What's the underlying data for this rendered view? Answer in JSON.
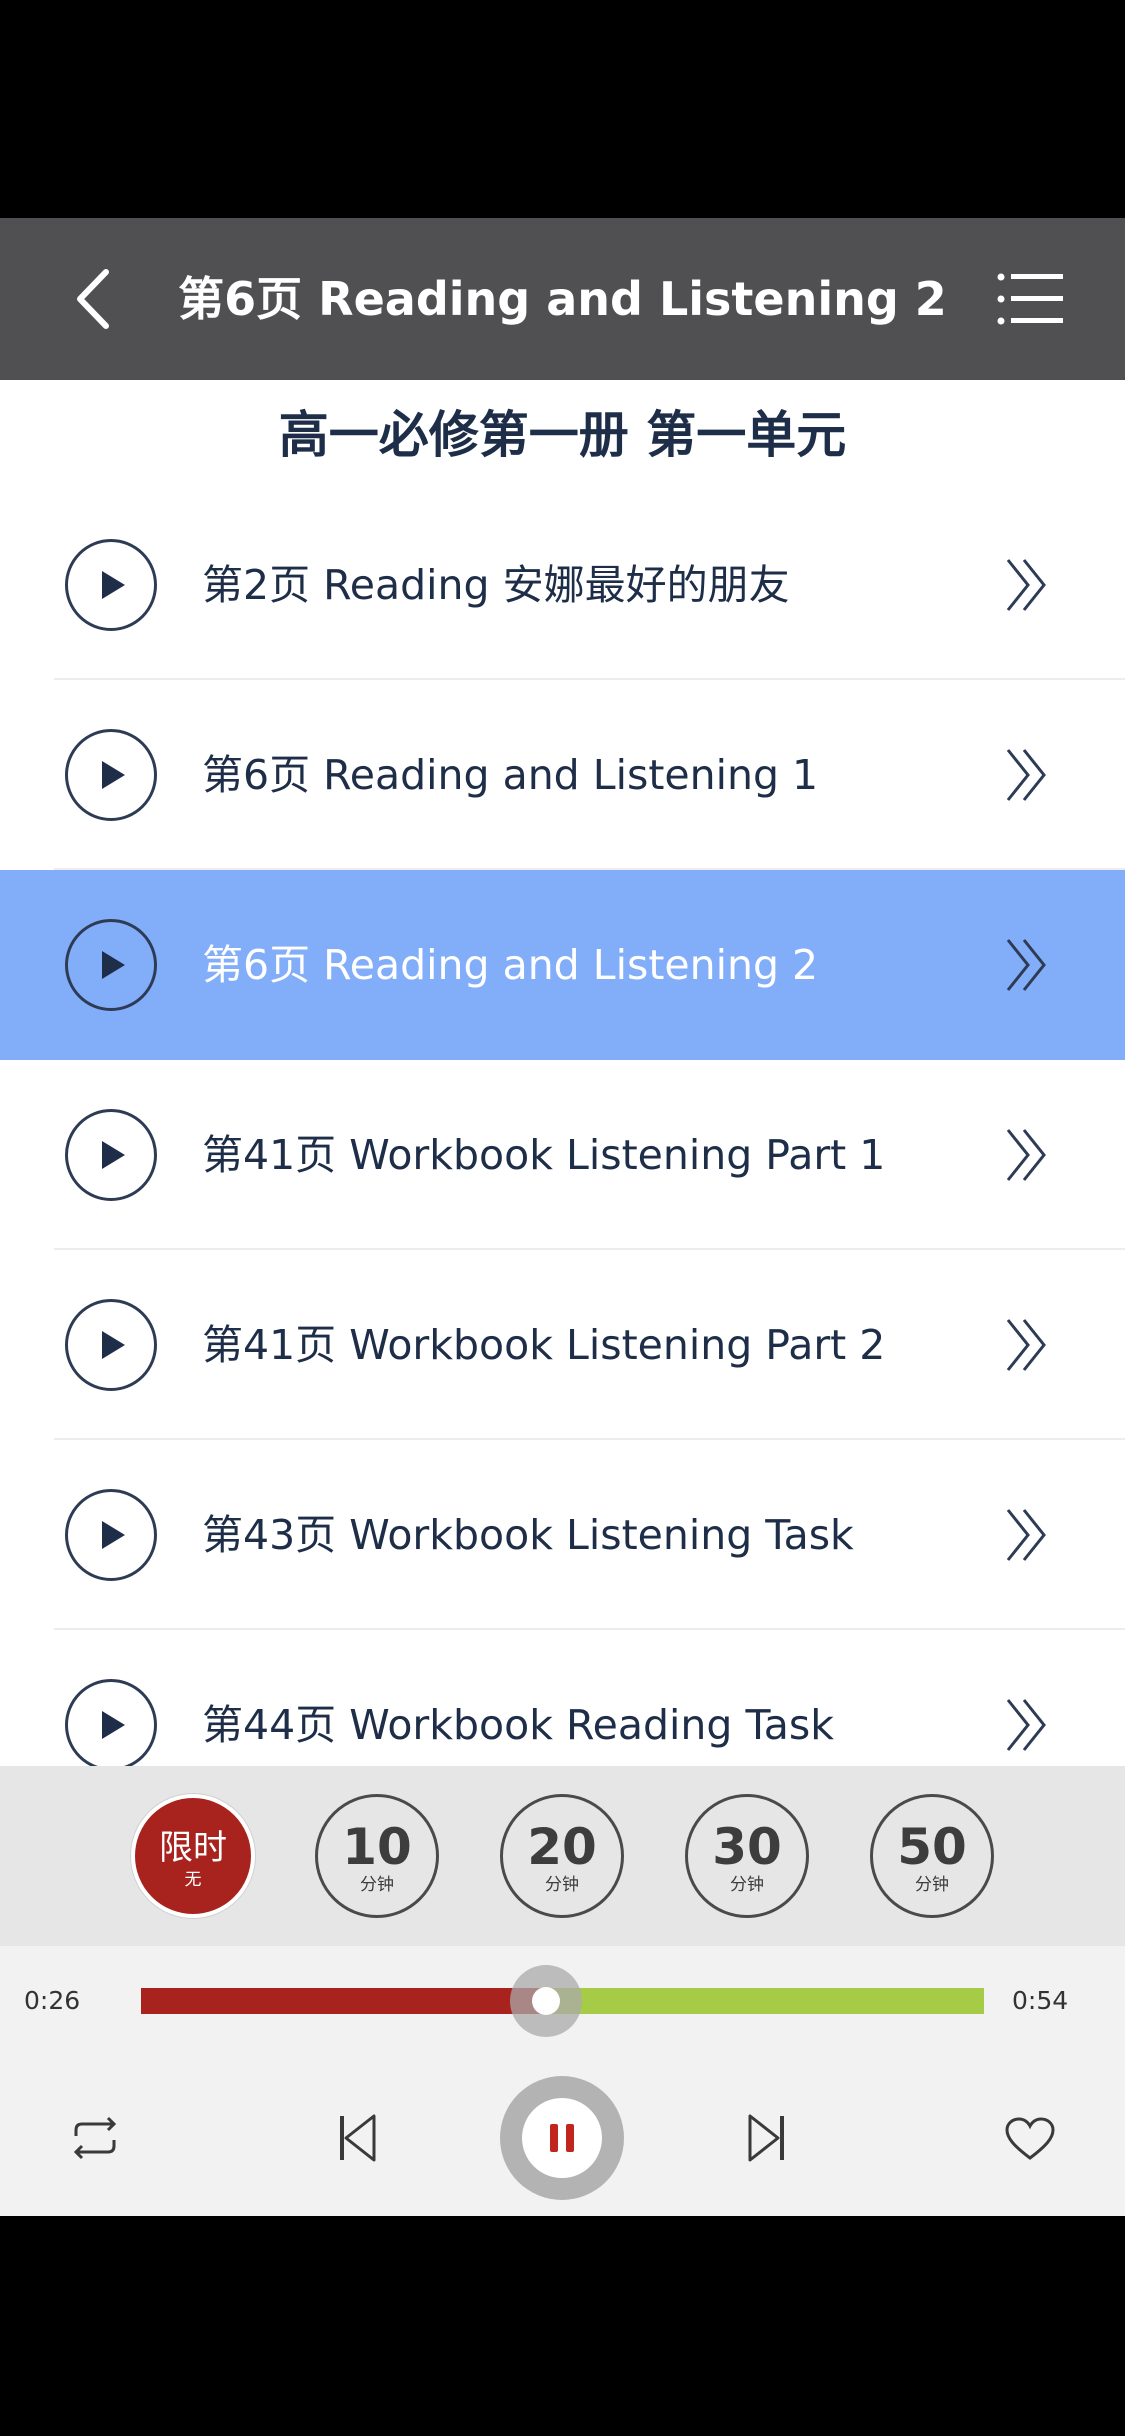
{
  "nav": {
    "title": "第6页 Reading and Listening 2",
    "back_icon": "chevron-left-icon",
    "menu_icon": "list-menu-icon"
  },
  "section": {
    "title": "高一必修第一册 第一单元"
  },
  "tracks": [
    {
      "label": "第2页 Reading 安娜最好的朋友",
      "active": false
    },
    {
      "label": "第6页 Reading and Listening 1",
      "active": false
    },
    {
      "label": "第6页 Reading and Listening 2",
      "active": true
    },
    {
      "label": "第41页 Workbook Listening Part 1",
      "active": false
    },
    {
      "label": "第41页 Workbook Listening Part 2",
      "active": false
    },
    {
      "label": "第43页 Workbook Listening Task",
      "active": false
    },
    {
      "label": "第44页 Workbook Reading Task",
      "active": false
    }
  ],
  "timers": [
    {
      "main": "限时",
      "sub": "无",
      "selected": true
    },
    {
      "main": "10",
      "sub": "分钟",
      "selected": false
    },
    {
      "main": "20",
      "sub": "分钟",
      "selected": false
    },
    {
      "main": "30",
      "sub": "分钟",
      "selected": false
    },
    {
      "main": "50",
      "sub": "分钟",
      "selected": false
    }
  ],
  "player": {
    "elapsed": "0:26",
    "total": "0:54",
    "progress_fraction": 0.48
  },
  "colors": {
    "nav_bg": "#505052",
    "active_row": "#82adf8",
    "text_dark": "#1e2e48",
    "played": "#a8231d",
    "remaining": "#a6cb47"
  }
}
